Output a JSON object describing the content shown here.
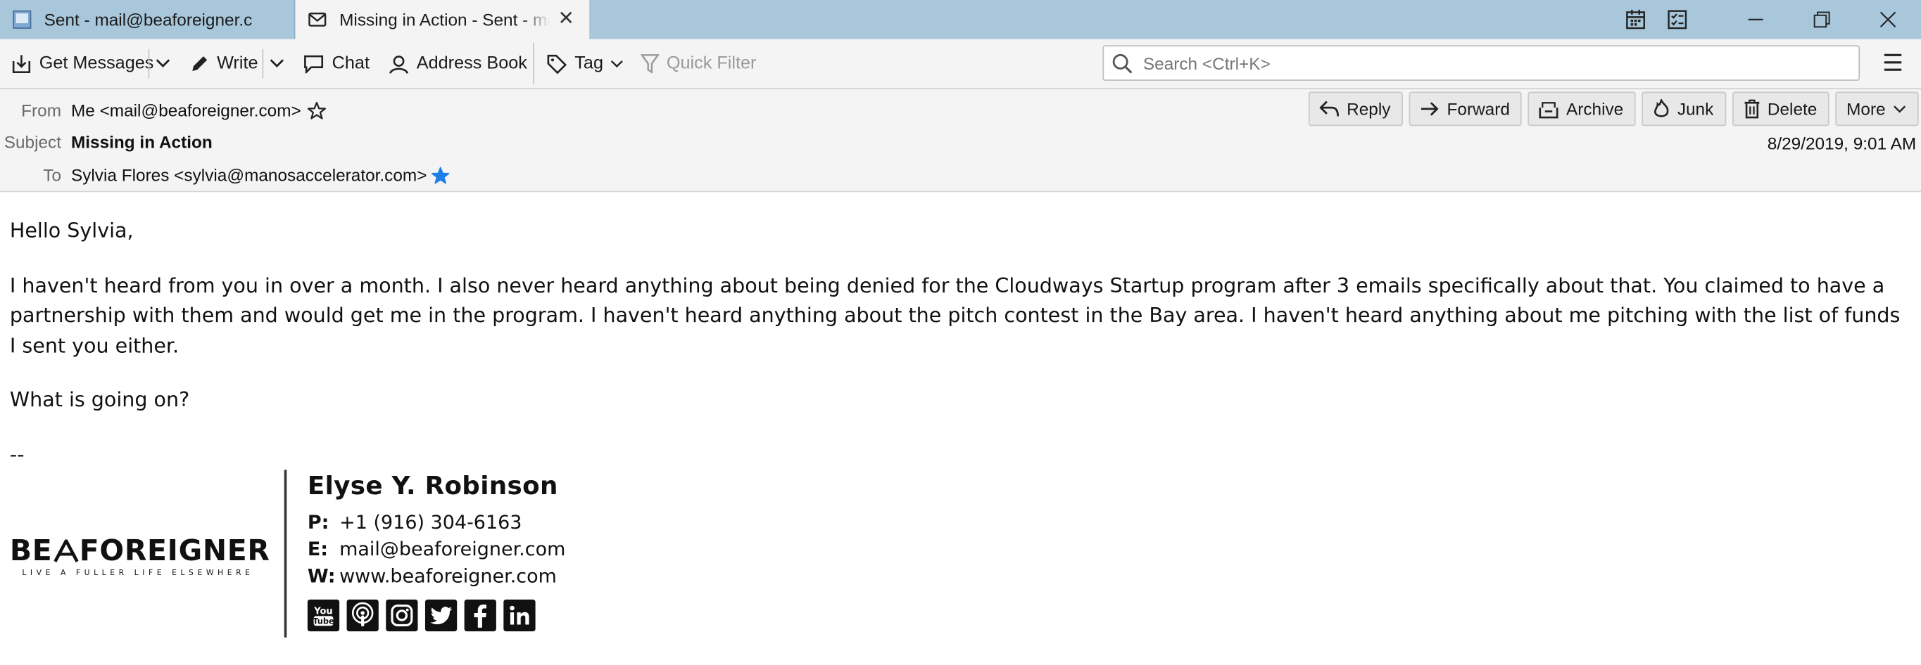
{
  "tabs": [
    {
      "label": "Sent - mail@beaforeigner.com",
      "icon": "mail-folder-icon",
      "active": false
    },
    {
      "label": "Missing in Action - Sent - mail@beaforeigner.com",
      "icon": "envelope-icon",
      "active": true
    }
  ],
  "toolbar": {
    "get_messages": "Get Messages",
    "write": "Write",
    "chat": "Chat",
    "address_book": "Address Book",
    "tag": "Tag",
    "quick_filter": "Quick Filter",
    "search_placeholder": "Search <Ctrl+K>"
  },
  "header": {
    "from_label": "From",
    "from_value": "Me <mail@beaforeigner.com>",
    "subject_label": "Subject",
    "subject_value": "Missing in Action",
    "to_label": "To",
    "to_value": "Sylvia Flores <sylvia@manosaccelerator.com>",
    "date": "8/29/2019, 9:01 AM",
    "actions": {
      "reply": "Reply",
      "forward": "Forward",
      "archive": "Archive",
      "junk": "Junk",
      "delete": "Delete",
      "more": "More"
    }
  },
  "message": {
    "greeting": "Hello Sylvia,",
    "paragraph1": "I haven't heard from you in over a month. I also never heard anything about being denied for the Cloudways Startup program after 3 emails specifically about that. You claimed to have a partnership with them and would get me in the program. I haven't heard anything about the pitch contest in the Bay area. I haven't heard anything about me pitching with the list of funds I sent you either.",
    "paragraph2": "What is going on?",
    "sig_separator": "--"
  },
  "signature": {
    "logo_text": "BE A FOREIGNER",
    "logo_tagline": "LIVE A FULLER LIFE ELSEWHERE",
    "name": "Elyse Y. Robinson",
    "phone_label": "P:",
    "phone": "+1 (916) 304-6163",
    "email_label": "E:",
    "email": "mail@beaforeigner.com",
    "web_label": "W:",
    "web": "www.beaforeigner.com",
    "social": [
      "youtube-icon",
      "podcast-icon",
      "instagram-icon",
      "twitter-icon",
      "facebook-icon",
      "linkedin-icon"
    ]
  },
  "colors": {
    "tabbar": "#a8c7db",
    "toolbar": "#f4f4f4",
    "star_contact": "#1e7fe6"
  }
}
